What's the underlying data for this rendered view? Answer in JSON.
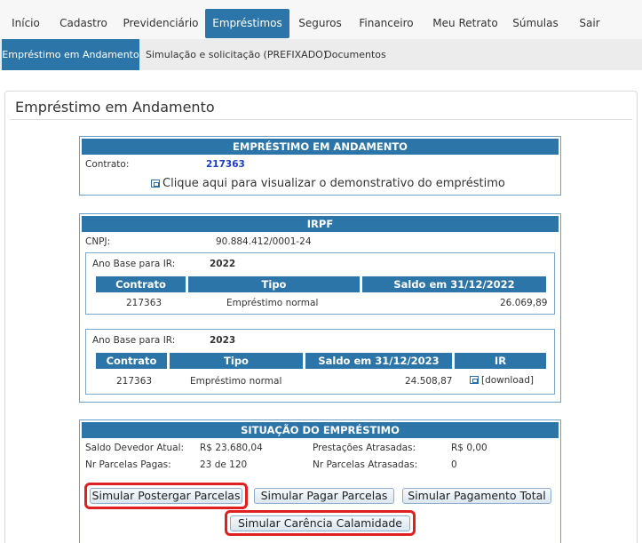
{
  "topnav": {
    "items": [
      "Início",
      "Cadastro",
      "Previdenciário",
      "Empréstimos",
      "Seguros",
      "Financeiro",
      "Meu Retrato",
      "Súmulas",
      "Sair"
    ],
    "active": "Empréstimos"
  },
  "subnav": {
    "items": [
      "Empréstimo em Andamento",
      "Simulação e solicitação (PREFIXADO)",
      "Documentos"
    ],
    "active": "Empréstimo em Andamento"
  },
  "panel": {
    "title": "Empréstimo em Andamento"
  },
  "loan": {
    "header": "EMPRÉSTIMO EM ANDAMENTO",
    "contract_label": "Contrato:",
    "contract_value": "217363",
    "statement_link": "Clique aqui para visualizar o demonstrativo do empréstimo"
  },
  "irpf": {
    "header": "IRPF",
    "cnpj_label": "CNPJ:",
    "cnpj_value": "90.884.412/0001-24",
    "years": [
      {
        "label": "Ano Base para IR:",
        "year": "2022",
        "columns": [
          "Contrato",
          "Tipo",
          "Saldo em 31/12/2022"
        ],
        "row": {
          "contrato": "217363",
          "tipo": "Empréstimo normal",
          "saldo": "26.069,89"
        }
      },
      {
        "label": "Ano Base para IR:",
        "year": "2023",
        "columns": [
          "Contrato",
          "Tipo",
          "Saldo em 31/12/2023",
          "IR"
        ],
        "row": {
          "contrato": "217363",
          "tipo": "Empréstimo normal",
          "saldo": "24.508,87",
          "ir": "[download]"
        }
      }
    ]
  },
  "situacao": {
    "header": "SITUAÇÃO DO EMPRÉSTIMO",
    "saldo_label": "Saldo Devedor Atual:",
    "saldo_value": "R$ 23.680,04",
    "pagas_label": "Nr Parcelas Pagas:",
    "pagas_value": "23 de 120",
    "prest_atrasadas_label": "Prestações Atrasadas:",
    "prest_atrasadas_value": "R$ 0,00",
    "nr_atrasadas_label": "Nr Parcelas Atrasadas:",
    "nr_atrasadas_value": "0",
    "buttons": {
      "postergar": "Simular Postergar Parcelas",
      "pagar": "Simular Pagar Parcelas",
      "total": "Simular Pagamento Total",
      "carencia": "Simular Carência Calamidade"
    }
  },
  "colors": {
    "accent": "#2c75a8",
    "highlight": "#e02020",
    "link": "#1a3fc4"
  },
  "icons": {
    "statement": "external-window-icon",
    "download": "external-window-icon"
  }
}
